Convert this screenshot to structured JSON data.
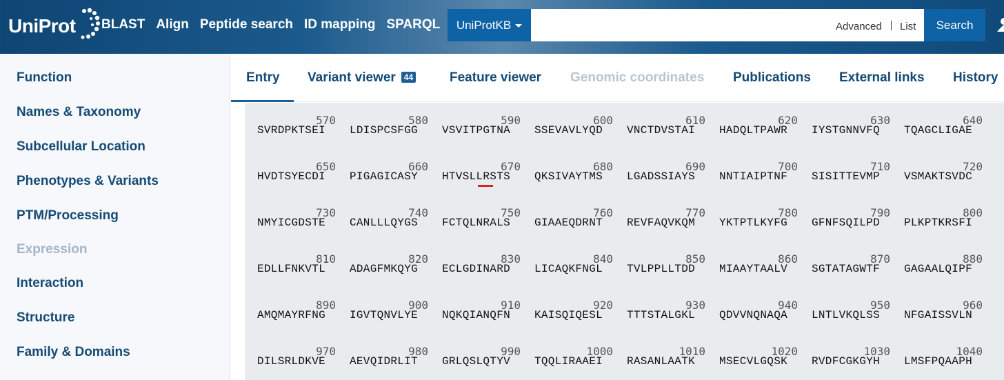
{
  "header": {
    "logo_text": "UniProt",
    "nav": [
      "BLAST",
      "Align",
      "Peptide search",
      "ID mapping",
      "SPARQL"
    ],
    "db_select": "UniProtKB",
    "search_value": "",
    "advanced_label": "Advanced",
    "list_label": "List",
    "search_button": "Search"
  },
  "sidebar": {
    "items": [
      {
        "label": "Function",
        "disabled": false
      },
      {
        "label": "Names & Taxonomy",
        "disabled": false
      },
      {
        "label": "Subcellular Location",
        "disabled": false
      },
      {
        "label": "Phenotypes & Variants",
        "disabled": false
      },
      {
        "label": "PTM/Processing",
        "disabled": false
      },
      {
        "label": "Expression",
        "disabled": true
      },
      {
        "label": "Interaction",
        "disabled": false
      },
      {
        "label": "Structure",
        "disabled": false
      },
      {
        "label": "Family & Domains",
        "disabled": false
      }
    ]
  },
  "tabs": {
    "entry": "Entry",
    "variant_viewer": "Variant viewer",
    "variant_count": "44",
    "feature_viewer": "Feature viewer",
    "genomic_coordinates": "Genomic coordinates",
    "publications": "Publications",
    "external_links": "External links",
    "history": "History"
  },
  "sequence": {
    "rows": [
      {
        "nums": [
          "570",
          "580",
          "590",
          "600",
          "610",
          "620",
          "630",
          "640"
        ],
        "seqs": [
          "SVRDPKTSEI",
          "LDISPCSFGG",
          "VSVITPGTNA",
          "SSEVAVLYQD",
          "VNCTDVSTAI",
          "HADQLTPAWR",
          "IYSTGNNVFQ",
          "TQAGCLIGAE"
        ]
      },
      {
        "nums": [
          "650",
          "660",
          "670",
          "680",
          "690",
          "700",
          "710",
          "720"
        ],
        "seqs": [
          "HVDTSYECDI",
          "PIGAGICASY",
          "HTVSLLRSTS",
          "QKSIVAYTMS",
          "LGADSSIAYS",
          "NNTIAIPTNF",
          "SISITTEVMP",
          "VSMAKTSVDC"
        ]
      },
      {
        "nums": [
          "730",
          "740",
          "750",
          "760",
          "770",
          "780",
          "790",
          "800"
        ],
        "seqs": [
          "NMYICGDSTE",
          "CANLLLQYGS",
          "FCTQLNRALS",
          "GIAAEQDRNT",
          "REVFAQVKQM",
          "YKTPTLKYFG",
          "GFNFSQILPD",
          "PLKPTKRSFI"
        ]
      },
      {
        "nums": [
          "810",
          "820",
          "830",
          "840",
          "850",
          "860",
          "870",
          "880"
        ],
        "seqs": [
          "EDLLFNKVTL",
          "ADAGFMKQYG",
          "ECLGDINARD",
          "LICAQKFNGL",
          "TVLPPLLTDD",
          "MIAAYTAALV",
          "SGTATAGWTF",
          "GAGAALQIPF"
        ]
      },
      {
        "nums": [
          "890",
          "900",
          "910",
          "920",
          "930",
          "940",
          "950",
          "960"
        ],
        "seqs": [
          "AMQMAYRFNG",
          "IGVTQNVLYE",
          "NQKQIANQFN",
          "KAISQIQESL",
          "TTTSTALGKL",
          "QDVVNQNAQA",
          "LNTLVKQLSS",
          "NFGAISSVLN"
        ]
      },
      {
        "nums": [
          "970",
          "980",
          "990",
          "1000",
          "1010",
          "1020",
          "1030",
          "1040"
        ],
        "seqs": [
          "DILSRLDKVE",
          "AEVQIDRLIT",
          "GRLQSLQTYV",
          "TQQLIRAAEI",
          "RASANLAATK",
          "MSECVLGQSK",
          "RVDFCGKGYH",
          "LMSFPQAAPH"
        ]
      }
    ]
  }
}
